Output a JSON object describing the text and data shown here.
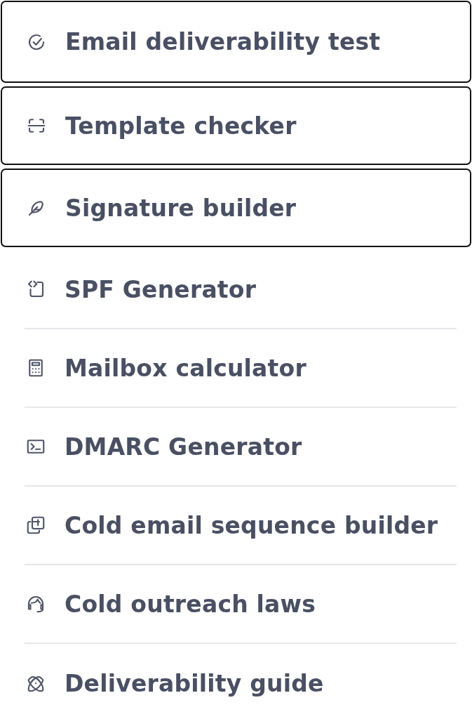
{
  "tools": [
    {
      "label": "Email deliverability test",
      "outlined": true
    },
    {
      "label": "Template checker",
      "outlined": true
    },
    {
      "label": "Signature builder",
      "outlined": true
    },
    {
      "label": "SPF Generator",
      "outlined": false
    },
    {
      "label": "Mailbox calculator",
      "outlined": false
    },
    {
      "label": "DMARC Generator",
      "outlined": false
    },
    {
      "label": "Cold email sequence builder",
      "outlined": false
    },
    {
      "label": "Cold outreach laws",
      "outlined": false
    },
    {
      "label": "Deliverability guide",
      "outlined": false
    }
  ]
}
